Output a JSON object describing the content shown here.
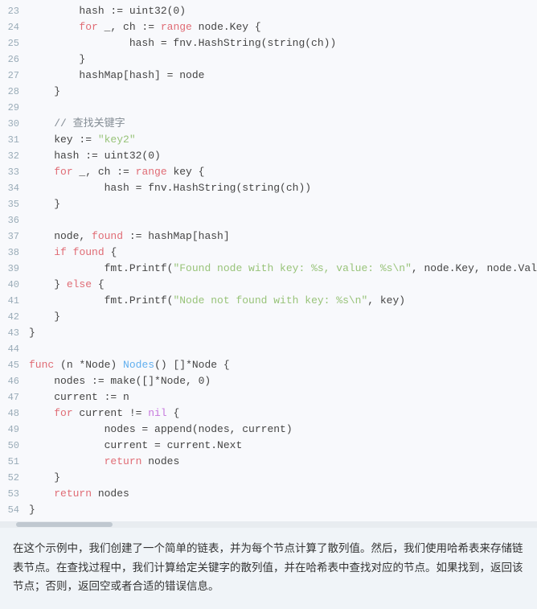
{
  "code": {
    "lines": [
      {
        "num": 23,
        "tokens": [
          {
            "t": "        hash := uint32(0)",
            "c": "plain"
          }
        ]
      },
      {
        "num": 24,
        "tokens": [
          {
            "t": "        ",
            "c": "plain"
          },
          {
            "t": "for",
            "c": "kw"
          },
          {
            "t": " _, ch := ",
            "c": "plain"
          },
          {
            "t": "range",
            "c": "kw"
          },
          {
            "t": " node.Key {",
            "c": "plain"
          }
        ]
      },
      {
        "num": 25,
        "tokens": [
          {
            "t": "                hash = fnv.HashString(string(ch))",
            "c": "plain"
          }
        ]
      },
      {
        "num": 26,
        "tokens": [
          {
            "t": "        }",
            "c": "plain"
          }
        ]
      },
      {
        "num": 27,
        "tokens": [
          {
            "t": "        hashMap[hash] = node",
            "c": "plain"
          }
        ]
      },
      {
        "num": 28,
        "tokens": [
          {
            "t": "    }",
            "c": "plain"
          }
        ]
      },
      {
        "num": 29,
        "tokens": [
          {
            "t": "",
            "c": "plain"
          }
        ]
      },
      {
        "num": 30,
        "tokens": [
          {
            "t": "    ",
            "c": "plain"
          },
          {
            "t": "// 查找关键字",
            "c": "cm"
          }
        ]
      },
      {
        "num": 31,
        "tokens": [
          {
            "t": "    key := ",
            "c": "plain"
          },
          {
            "t": "\"key2\"",
            "c": "str"
          }
        ]
      },
      {
        "num": 32,
        "tokens": [
          {
            "t": "    hash := uint32(0)",
            "c": "plain"
          }
        ]
      },
      {
        "num": 33,
        "tokens": [
          {
            "t": "    ",
            "c": "plain"
          },
          {
            "t": "for",
            "c": "kw"
          },
          {
            "t": " _, ch := ",
            "c": "plain"
          },
          {
            "t": "range",
            "c": "kw"
          },
          {
            "t": " key {",
            "c": "plain"
          }
        ]
      },
      {
        "num": 34,
        "tokens": [
          {
            "t": "            hash = fnv.HashString(string(ch))",
            "c": "plain"
          }
        ]
      },
      {
        "num": 35,
        "tokens": [
          {
            "t": "    }",
            "c": "plain"
          }
        ]
      },
      {
        "num": 36,
        "tokens": [
          {
            "t": "",
            "c": "plain"
          }
        ]
      },
      {
        "num": 37,
        "tokens": [
          {
            "t": "    node, ",
            "c": "plain"
          },
          {
            "t": "found",
            "c": "found-word"
          },
          {
            "t": " := hashMap[hash]",
            "c": "plain"
          }
        ]
      },
      {
        "num": 38,
        "tokens": [
          {
            "t": "    ",
            "c": "plain"
          },
          {
            "t": "if",
            "c": "kw"
          },
          {
            "t": " ",
            "c": "plain"
          },
          {
            "t": "found",
            "c": "found-word"
          },
          {
            "t": " {",
            "c": "plain"
          }
        ]
      },
      {
        "num": 39,
        "tokens": [
          {
            "t": "            fmt.Printf(",
            "c": "plain"
          },
          {
            "t": "\"Found node with key: %s, value: %s\\n\"",
            "c": "str"
          },
          {
            "t": ", node.Key, node.Val",
            "c": "plain"
          }
        ]
      },
      {
        "num": 40,
        "tokens": [
          {
            "t": "    } ",
            "c": "plain"
          },
          {
            "t": "else",
            "c": "kw"
          },
          {
            "t": " {",
            "c": "plain"
          }
        ]
      },
      {
        "num": 41,
        "tokens": [
          {
            "t": "            fmt.Printf(",
            "c": "plain"
          },
          {
            "t": "\"Node not found with key: %s\\n\"",
            "c": "str"
          },
          {
            "t": ", key)",
            "c": "plain"
          }
        ]
      },
      {
        "num": 42,
        "tokens": [
          {
            "t": "    }",
            "c": "plain"
          }
        ]
      },
      {
        "num": 43,
        "tokens": [
          {
            "t": "}",
            "c": "plain"
          }
        ]
      },
      {
        "num": 44,
        "tokens": [
          {
            "t": "",
            "c": "plain"
          }
        ]
      },
      {
        "num": 45,
        "tokens": [
          {
            "t": "func",
            "c": "kw"
          },
          {
            "t": " (n *Node) ",
            "c": "plain"
          },
          {
            "t": "Nodes",
            "c": "fn"
          },
          {
            "t": "() []*Node {",
            "c": "plain"
          }
        ]
      },
      {
        "num": 46,
        "tokens": [
          {
            "t": "    nodes := make([]*Node, 0)",
            "c": "plain"
          }
        ]
      },
      {
        "num": 47,
        "tokens": [
          {
            "t": "    current := n",
            "c": "plain"
          }
        ]
      },
      {
        "num": 48,
        "tokens": [
          {
            "t": "    ",
            "c": "plain"
          },
          {
            "t": "for",
            "c": "kw"
          },
          {
            "t": " current != ",
            "c": "plain"
          },
          {
            "t": "nil",
            "c": "kw2"
          },
          {
            "t": " {",
            "c": "plain"
          }
        ]
      },
      {
        "num": 49,
        "tokens": [
          {
            "t": "            nodes = append(nodes, current)",
            "c": "plain"
          }
        ]
      },
      {
        "num": 50,
        "tokens": [
          {
            "t": "            current = current.Next",
            "c": "plain"
          }
        ]
      },
      {
        "num": 51,
        "tokens": [
          {
            "t": "            ",
            "c": "plain"
          },
          {
            "t": "return",
            "c": "kw"
          },
          {
            "t": " nodes",
            "c": "plain"
          }
        ]
      },
      {
        "num": 52,
        "tokens": [
          {
            "t": "    }",
            "c": "plain"
          }
        ]
      },
      {
        "num": 53,
        "tokens": [
          {
            "t": "    ",
            "c": "plain"
          },
          {
            "t": "return",
            "c": "kw"
          },
          {
            "t": " nodes",
            "c": "plain"
          }
        ]
      },
      {
        "num": 54,
        "tokens": [
          {
            "t": "}",
            "c": "plain"
          }
        ]
      }
    ]
  },
  "description": "在这个示例中，我们创建了一个简单的链表，并为每个节点计算了散列值。然后，我们使用哈希表来存储链表节点。在查找过程中，我们计算给定关键字的散列值，并在哈希表中查找对应的节点。如果找到，返回该节点；否则，返回空或者合适的错误信息。"
}
